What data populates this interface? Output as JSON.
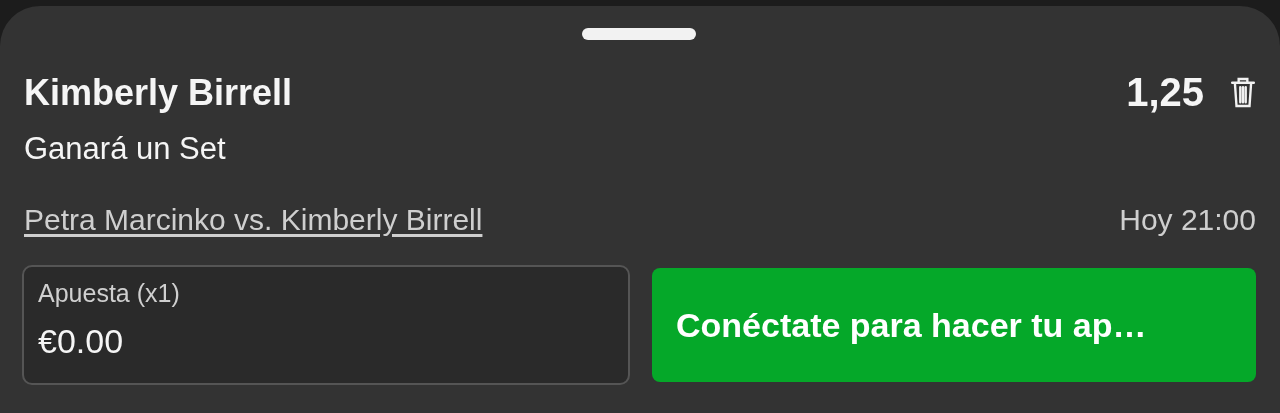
{
  "selection": {
    "name": "Kimberly Birrell",
    "odds": "1,25",
    "market": "Ganará un Set",
    "event": "Petra Marcinko vs. Kimberly Birrell",
    "time": "Hoy 21:00"
  },
  "stake": {
    "label": "Apuesta (x1)",
    "value": "€0.00"
  },
  "action_button": "Conéctate para hacer tu ap…"
}
